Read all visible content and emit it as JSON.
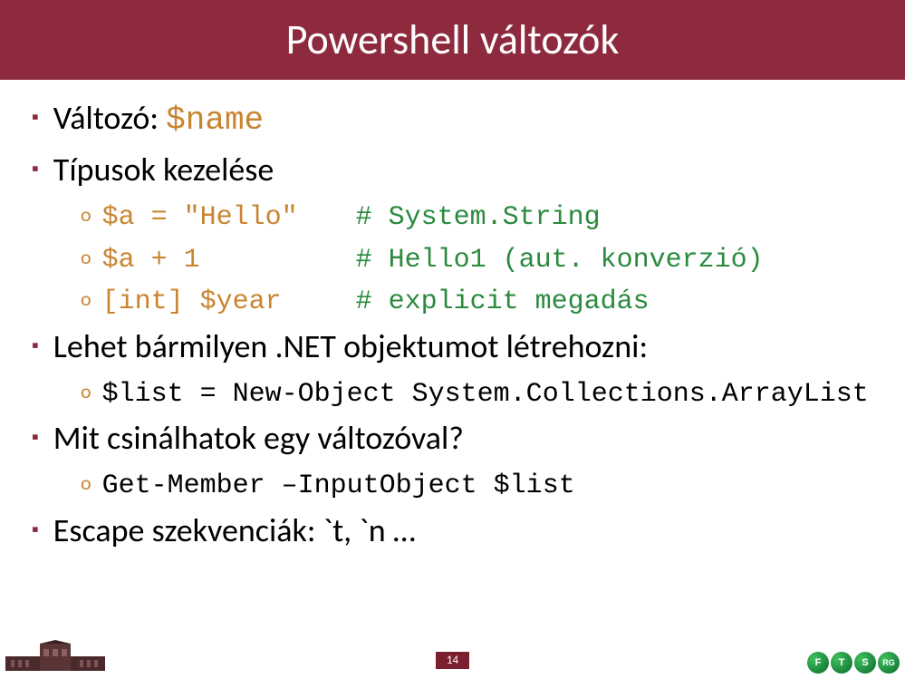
{
  "title": "Powershell változók",
  "bullets": {
    "b1_prefix": "Változó: ",
    "b1_var": "$name",
    "b2": "Típusok kezelése",
    "b2_1_code": "$a = \"Hello\"",
    "b2_1_comment": "# System.String",
    "b2_2_code": "$a + 1",
    "b2_2_comment": "# Hello1 (aut. konverzió)",
    "b2_3_code": "[int] $year",
    "b2_3_comment": "# explicit megadás",
    "b3": "Lehet bármilyen .NET objektumot létrehozni:",
    "b3_1_code": "$list = New-Object System.Collections.ArrayList",
    "b4": "Mit csinálhatok egy változóval?",
    "b4_1_code": "Get-Member –InputObject $list",
    "b5_prefix": "Escape szekvenciák: ",
    "b5_suffix": "`t, `n …"
  },
  "footer": {
    "page": "14",
    "left_logo_label": "BME building logo",
    "right_letters": {
      "a": "F",
      "b": "T",
      "c": "S",
      "d": "RG"
    }
  }
}
